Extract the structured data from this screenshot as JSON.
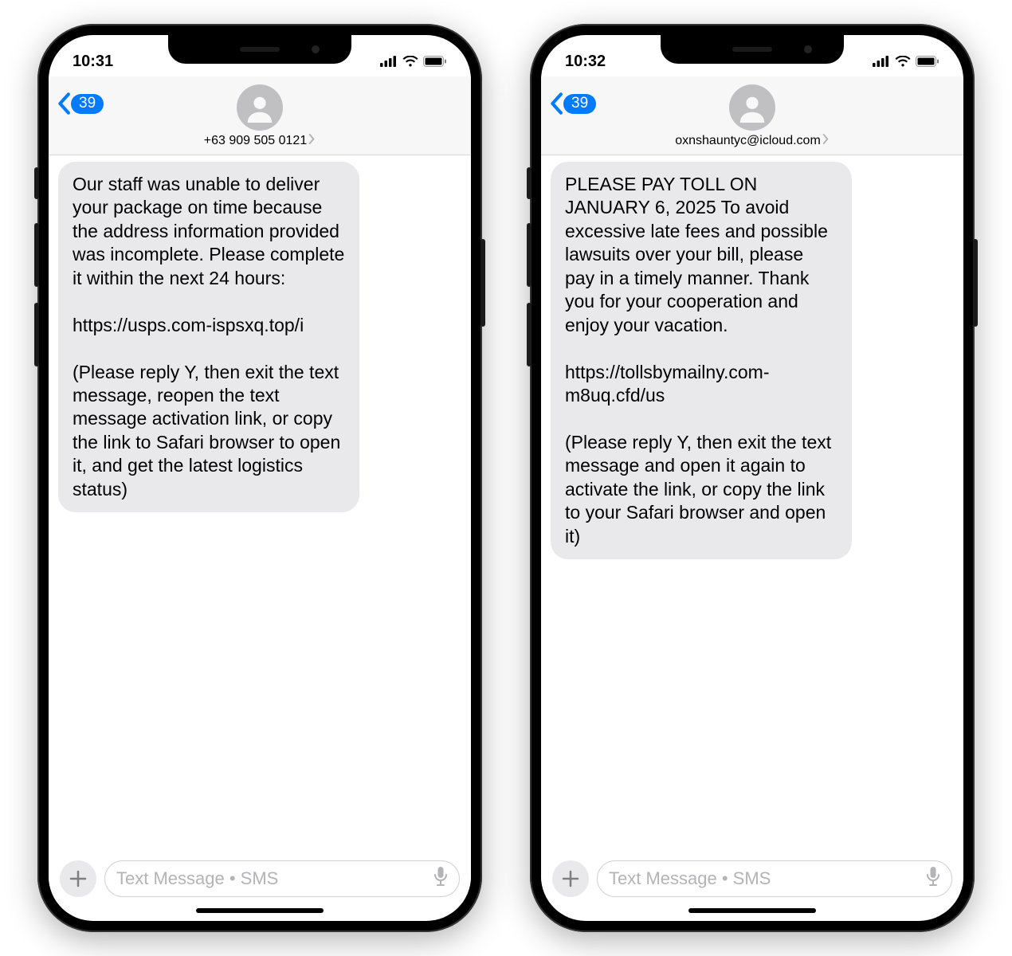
{
  "phones": [
    {
      "time": "10:31",
      "back_count": "39",
      "sender": "+63 909 505 0121",
      "message": "Our staff was unable to deliver your package on time because the address information provided was incomplete. Please complete it within the next 24 hours:\n\nhttps://usps.com-ispsxq.top/i\n\n(Please reply Y, then exit the text message, reopen the text message activation link, or copy the link to Safari browser to open it, and get the latest logistics status)",
      "placeholder": "Text Message • SMS"
    },
    {
      "time": "10:32",
      "back_count": "39",
      "sender": "oxnshauntyc@icloud.com",
      "message": "PLEASE PAY TOLL ON JANUARY 6, 2025 To avoid excessive late fees and possible lawsuits over your bill, please pay in a timely manner. Thank you for your cooperation and enjoy your vacation.\n\nhttps://tollsbymailny.com-m8uq.cfd/us\n\n(Please reply Y, then exit the text message and open it again to activate the link, or copy the link to your Safari browser and open it)",
      "placeholder": "Text Message • SMS"
    }
  ]
}
